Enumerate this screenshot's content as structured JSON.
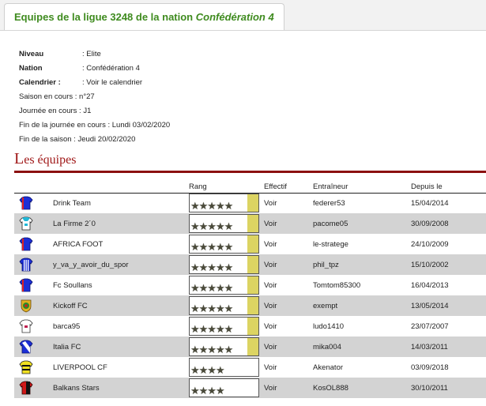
{
  "tab": {
    "title_prefix": "Equipes de la ligue 3248 de la nation ",
    "title_nation": "Confédération 4"
  },
  "info": {
    "niveau_label": "Niveau",
    "niveau_value": ": Elite",
    "nation_label": "Nation",
    "nation_value": ": Confédération 4",
    "calendrier_label": "Calendrier :",
    "calendrier_link": ": Voir le calendrier",
    "saison": "Saison en cours : n°27",
    "journee": "Journée en cours : J1",
    "fin_journee": "Fin de la journée en cours : Lundi 03/02/2020",
    "fin_saison": "Fin de la saison : Jeudi 20/02/2020"
  },
  "section": {
    "title_first": "L",
    "title_rest": "es équipes"
  },
  "columns": {
    "rang": "Rang",
    "effectif": "Effectif",
    "entraineur": "Entraîneur",
    "depuis": "Depuis le"
  },
  "teams": [
    {
      "name": "Drink Team",
      "stars": "★★★★★",
      "rank_fill": 0.16,
      "effectif": "Voir",
      "coach": "federer53",
      "since": "15/04/2014",
      "jersey": "blue-shirt-icon"
    },
    {
      "name": "La Firme 2´0",
      "stars": "★★★★★",
      "rank_fill": 0.16,
      "effectif": "Voir",
      "coach": "pacome05",
      "since": "30/09/2008",
      "jersey": "cyan-shirt-icon"
    },
    {
      "name": "AFRICA FOOT",
      "stars": "★★★★★",
      "rank_fill": 0.16,
      "effectif": "Voir",
      "coach": "le-stratege",
      "since": "24/10/2009",
      "jersey": "blue-shirt-icon"
    },
    {
      "name": "y_va_y_avoir_du_spor",
      "stars": "★★★★★",
      "rank_fill": 0.16,
      "effectif": "Voir",
      "coach": "phil_tpz",
      "since": "15/10/2002",
      "jersey": "striped-shirt-icon"
    },
    {
      "name": "Fc Soullans",
      "stars": "★★★★★",
      "rank_fill": 0.16,
      "effectif": "Voir",
      "coach": "Tomtom85300",
      "since": "16/04/2013",
      "jersey": "blue-shirt-icon"
    },
    {
      "name": "Kickoff FC",
      "stars": "★★★★★",
      "rank_fill": 0.16,
      "effectif": "Voir",
      "coach": "exempt",
      "since": "13/05/2014",
      "jersey": "crest-icon"
    },
    {
      "name": "barca95",
      "stars": "★★★★★",
      "rank_fill": 0.16,
      "effectif": "Voir",
      "coach": "ludo1410",
      "since": "23/07/2007",
      "jersey": "white-shirt-icon"
    },
    {
      "name": "Italia FC",
      "stars": "★★★★★",
      "rank_fill": 0.16,
      "effectif": "Voir",
      "coach": "mika004",
      "since": "14/03/2011",
      "jersey": "blue-white-shirt-icon"
    },
    {
      "name": "LIVERPOOL CF",
      "stars": "★★★★",
      "rank_fill": 0,
      "effectif": "Voir",
      "coach": "Akenator",
      "since": "03/09/2018",
      "jersey": "yellow-shirt-icon"
    },
    {
      "name": "Balkans Stars",
      "stars": "★★★★",
      "rank_fill": 0,
      "effectif": "Voir",
      "coach": "KosOL888",
      "since": "30/10/2011",
      "jersey": "red-black-shirt-icon"
    }
  ]
}
